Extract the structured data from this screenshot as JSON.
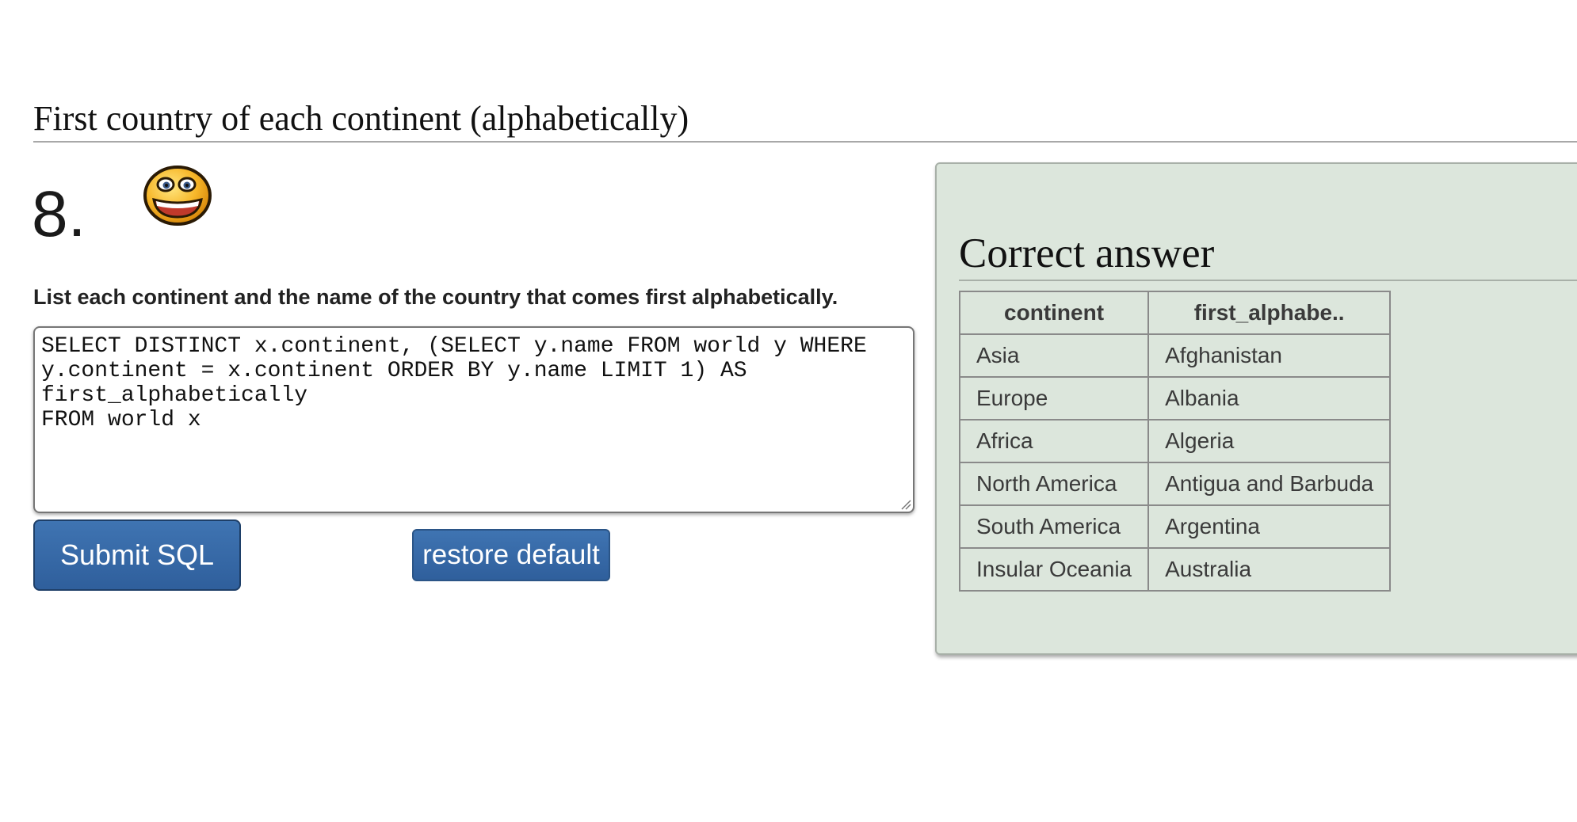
{
  "section": {
    "title": "First country of each continent (alphabetically)"
  },
  "question": {
    "number": "8.",
    "smiley_icon": "grinning-smiley-icon",
    "text": "List each continent and the name of the country that comes first alphabetically.",
    "sql": "SELECT DISTINCT x.continent, (SELECT y.name FROM world y WHERE\ny.continent = x.continent ORDER BY y.name LIMIT 1) AS\nfirst_alphabetically\nFROM world x"
  },
  "buttons": {
    "submit_label": "Submit SQL",
    "restore_label": "restore default",
    "button_color": "#3a6ca8"
  },
  "answer": {
    "title": "Correct answer",
    "panel_color": "#dce6dc",
    "columns": [
      "continent",
      "first_alphabe.."
    ],
    "rows": [
      [
        "Asia",
        "Afghanistan"
      ],
      [
        "Europe",
        "Albania"
      ],
      [
        "Africa",
        "Algeria"
      ],
      [
        "North America",
        "Antigua and Barbuda"
      ],
      [
        "South America",
        "Argentina"
      ],
      [
        "Insular Oceania",
        "Australia"
      ]
    ]
  }
}
